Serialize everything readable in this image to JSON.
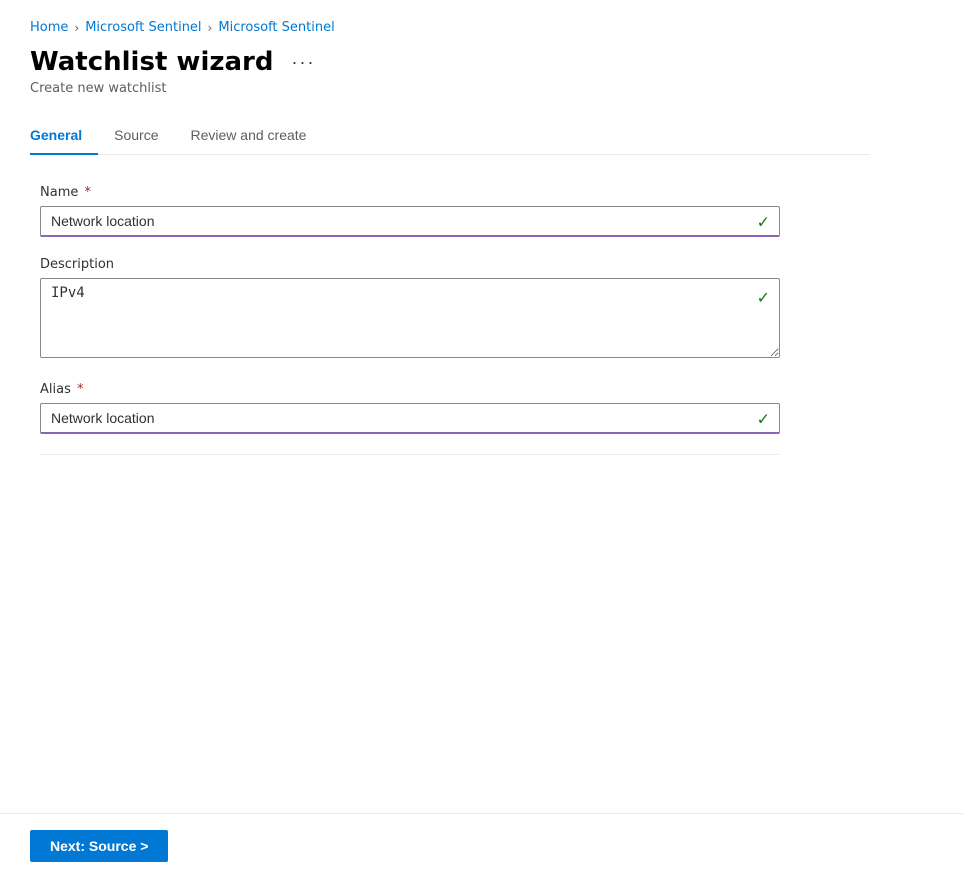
{
  "breadcrumb": {
    "items": [
      {
        "label": "Home",
        "href": "#"
      },
      {
        "label": "Microsoft Sentinel",
        "href": "#"
      },
      {
        "label": "Microsoft Sentinel",
        "href": "#"
      }
    ],
    "separator": "›"
  },
  "header": {
    "title": "Watchlist wizard",
    "more_options_label": "···",
    "subtitle": "Create new watchlist"
  },
  "tabs": [
    {
      "label": "General",
      "active": true,
      "id": "general"
    },
    {
      "label": "Source",
      "active": false,
      "id": "source"
    },
    {
      "label": "Review and create",
      "active": false,
      "id": "review"
    }
  ],
  "form": {
    "name_label": "Name",
    "name_required": true,
    "name_value": "Network location",
    "description_label": "Description",
    "description_required": false,
    "description_value": "IPv4",
    "alias_label": "Alias",
    "alias_required": true,
    "alias_value": "Network location"
  },
  "footer": {
    "next_button_label": "Next: Source >"
  }
}
